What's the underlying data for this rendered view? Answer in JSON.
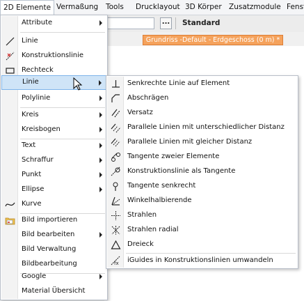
{
  "menubar": {
    "items": [
      {
        "label": "2D Elemente"
      },
      {
        "label": "Vermaßung"
      },
      {
        "label": "Tools"
      },
      {
        "label": "Drucklayout"
      },
      {
        "label": "3D Körper"
      },
      {
        "label": "Zusatzmodule"
      },
      {
        "label": "Fenst"
      }
    ]
  },
  "toolbar": {
    "dots_label": "...",
    "standard_label": "Standard"
  },
  "document_tab": {
    "label": "Grundriss -Default - Erdgeschoss (0 m) *"
  },
  "main_menu": {
    "items": [
      {
        "label": "Attribute"
      },
      {
        "label": "Linie"
      },
      {
        "label": "Konstruktionslinie"
      },
      {
        "label": "Rechteck"
      },
      {
        "label": "Linie"
      },
      {
        "label": "Polylinie"
      },
      {
        "label": "Kreis"
      },
      {
        "label": "Kreisbogen"
      },
      {
        "label": "Text"
      },
      {
        "label": "Schraffur"
      },
      {
        "label": "Punkt"
      },
      {
        "label": "Ellipse"
      },
      {
        "label": "Kurve"
      },
      {
        "label": "Bild importieren"
      },
      {
        "label": "Bild bearbeiten"
      },
      {
        "label": "Bild Verwaltung"
      },
      {
        "label": "Bildbearbeitung"
      },
      {
        "label": "Google"
      },
      {
        "label": "Material Übersicht"
      }
    ]
  },
  "sub_menu": {
    "items": [
      {
        "label": "Senkrechte Linie auf Element"
      },
      {
        "label": "Abschrägen"
      },
      {
        "label": "Versatz"
      },
      {
        "label": "Parallele Linien mit unterschiedlicher Distanz"
      },
      {
        "label": "Parallele Linien mit gleicher Distanz"
      },
      {
        "label": "Tangente zweier Elemente"
      },
      {
        "label": "Konstruktionslinie als Tangente"
      },
      {
        "label": "Tangente senkrecht"
      },
      {
        "label": "Winkelhalbierende"
      },
      {
        "label": "Strahlen"
      },
      {
        "label": "Strahlen radial"
      },
      {
        "label": "Dreieck"
      },
      {
        "label": "iGuides in Konstruktionslinien umwandeln"
      }
    ]
  },
  "colors": {
    "accent_tab": "#f5a25c",
    "highlight": "#cfe4f7",
    "highlight_border": "#7eb4ea"
  }
}
